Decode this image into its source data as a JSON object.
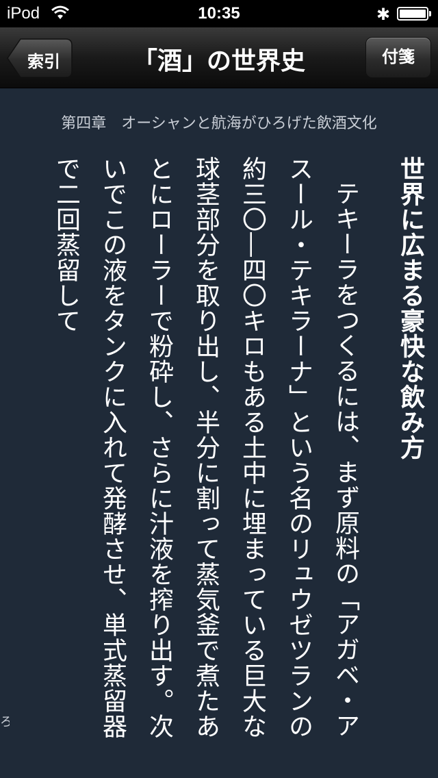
{
  "status_bar": {
    "carrier": "iPod",
    "time": "10:35",
    "bluetooth_glyph": "✱",
    "wifi_icon": "wifi-icon",
    "battery_icon": "battery-icon"
  },
  "nav": {
    "back_label": "索引",
    "title": "「酒」の世界史",
    "tag_label": "付箋"
  },
  "chapter_title": "第四章　オーシャンと航海がひろげた飲酒文化",
  "section_heading": "世界に広まる豪快な飲み方",
  "body_text": "テキーラをつくるには、まず原料の「アガベ・アスール・テキラーナ」という名のリュウゼツランの約三〇―四〇キロもある土中に埋まっている巨大な球茎部分を取り出し、半分に割って蒸気釜で煮たあとにローラーで粉砕し、さらに汁液を搾り出す。次いでこの液をタンクに入れて発酵させ、単式蒸留器で二回蒸留して",
  "page_edge_text": "ろ",
  "colors": {
    "page_background": "#1f2a38",
    "text": "#ffffff",
    "chapter_text": "#c9ced6",
    "navbar": "#1a1a1a"
  }
}
